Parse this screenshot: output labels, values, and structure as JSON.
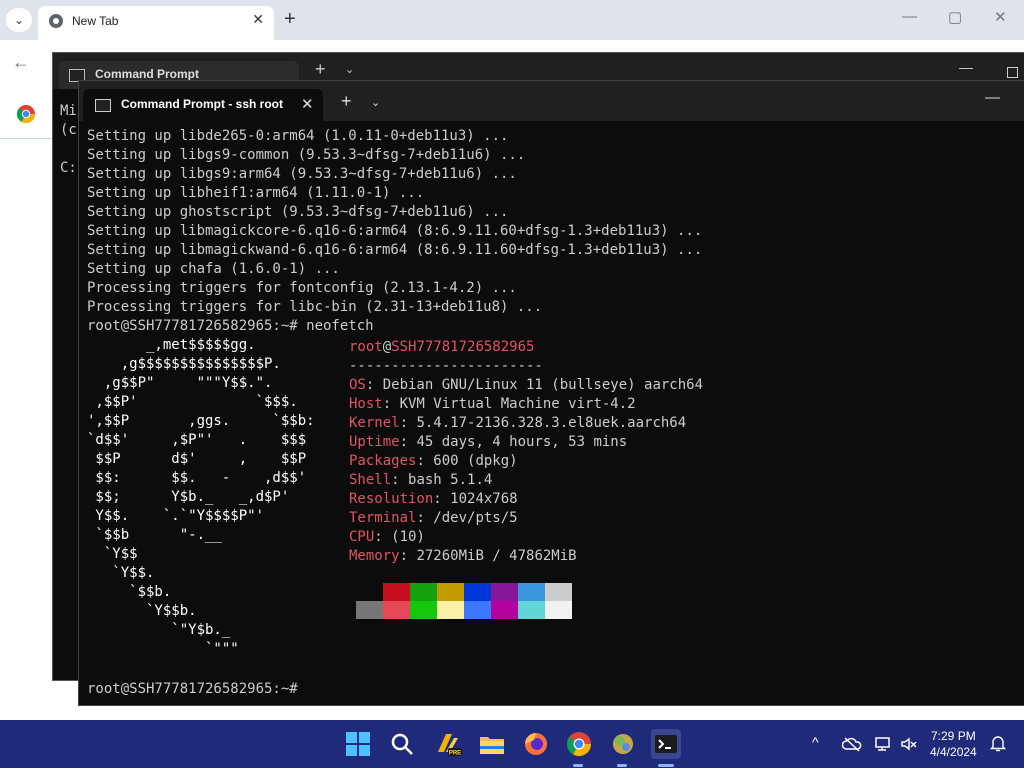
{
  "browser": {
    "tab_title": "New Tab",
    "close_glyph": "✕",
    "new_tab_glyph": "+",
    "search_tabs_glyph": "⌄",
    "back_glyph": "←",
    "minimize_glyph": "—",
    "maximize_glyph": "▢",
    "close_window_glyph": "✕"
  },
  "back_window": {
    "tab_title": "Command Prompt",
    "new_tab_glyph": "+",
    "chevron_glyph": "⌄",
    "minimize_glyph": "—",
    "content": "Mi\n(c\n\nC:"
  },
  "front_window": {
    "tab_title": "Command Prompt - ssh  root",
    "close_glyph": "✕",
    "new_tab_glyph": "+",
    "chevron_glyph": "⌄",
    "minimize_glyph": "—",
    "log_lines": [
      "Setting up libde265-0:arm64 (1.0.11-0+deb11u3) ...",
      "Setting up libgs9-common (9.53.3~dfsg-7+deb11u6) ...",
      "Setting up libgs9:arm64 (9.53.3~dfsg-7+deb11u6) ...",
      "Setting up libheif1:arm64 (1.11.0-1) ...",
      "Setting up ghostscript (9.53.3~dfsg-7+deb11u6) ...",
      "Setting up libmagickcore-6.q16-6:arm64 (8:6.9.11.60+dfsg-1.3+deb11u3) ...",
      "Setting up libmagickwand-6.q16-6:arm64 (8:6.9.11.60+dfsg-1.3+deb11u3) ...",
      "Setting up chafa (1.6.0-1) ...",
      "Processing triggers for fontconfig (2.13.1-4.2) ...",
      "Processing triggers for libc-bin (2.31-13+deb11u8) ...",
      "root@SSH77781726582965:~# neofetch"
    ],
    "logo_lines": [
      "       _,met$$$$$gg.",
      "    ,g$$$$$$$$$$$$$$$P.",
      "  ,g$$P\"     \"\"\"Y$$.\".",
      " ,$$P'              `$$$.",
      "',$$P       ,ggs.     `$$b:",
      "`d$$'     ,$P\"'   .    $$$",
      " $$P      d$'     ,    $$P",
      " $$:      $$.   -    ,d$$'",
      " $$;      Y$b._   _,d$P'",
      " Y$$.    `.`\"Y$$$$P\"'",
      " `$$b      \"-.__",
      "  `Y$$",
      "   `Y$$.",
      "     `$$b.",
      "       `Y$$b.",
      "          `\"Y$b._",
      "              `\"\"\""
    ],
    "user_host": {
      "user": "root",
      "at": "@",
      "host": "SSH77781726582965"
    },
    "separator": "-----------------------",
    "info": [
      {
        "key": "OS",
        "value": "Debian GNU/Linux 11 (bullseye) aarch64"
      },
      {
        "key": "Host",
        "value": "KVM Virtual Machine virt-4.2"
      },
      {
        "key": "Kernel",
        "value": "5.4.17-2136.328.3.el8uek.aarch64"
      },
      {
        "key": "Uptime",
        "value": "45 days, 4 hours, 53 mins"
      },
      {
        "key": "Packages",
        "value": "600 (dpkg)"
      },
      {
        "key": "Shell",
        "value": "bash 5.1.4"
      },
      {
        "key": "Resolution",
        "value": "1024x768"
      },
      {
        "key": "Terminal",
        "value": "/dev/pts/5"
      },
      {
        "key": "CPU",
        "value": "(10)"
      },
      {
        "key": "Memory",
        "value": "27260MiB / 47862MiB"
      }
    ],
    "colors_row1": [
      "#0c0c0c",
      "#c50f1f",
      "#13a10e",
      "#c19c00",
      "#0037da",
      "#881798",
      "#3a96dd",
      "#cccccc"
    ],
    "colors_row2": [
      "#767676",
      "#e74856",
      "#16c60c",
      "#f9f1a5",
      "#3b78ff",
      "#b4009e",
      "#61d6d6",
      "#f2f2f2"
    ],
    "final_prompt": "root@SSH77781726582965:~#"
  },
  "taskbar": {
    "apps": [
      "windows-start",
      "search",
      "pre-app",
      "file-explorer",
      "firefox",
      "chrome",
      "ball-app",
      "terminal"
    ],
    "time": "7:29 PM",
    "date": "4/4/2024",
    "tray_chevron": "^"
  }
}
